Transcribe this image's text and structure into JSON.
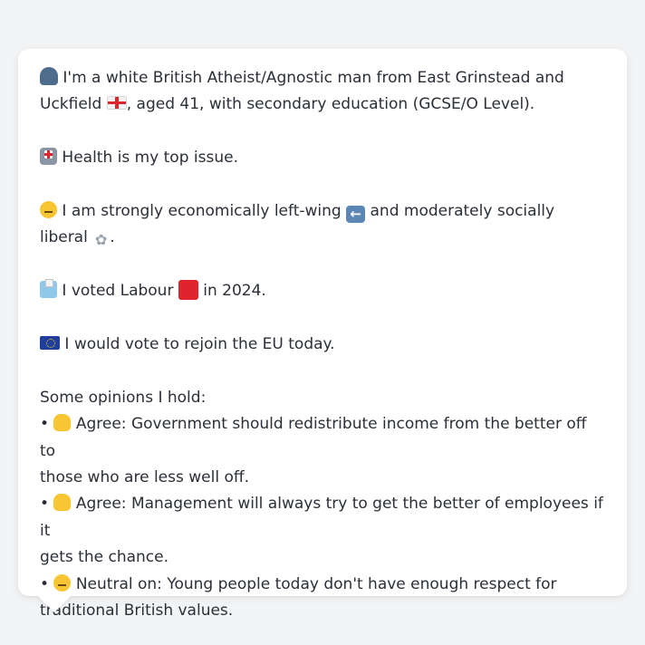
{
  "profile": {
    "intro_pre": "I'm a white British Atheist/Agnostic man from East Grinstead and Uckfield",
    "intro_post": ", aged 41, with secondary education (GCSE/O Level).",
    "top_issue": "Health is my top issue.",
    "ideology_pre": "I am strongly economically left-wing",
    "ideology_mid": "and moderately socially liberal",
    "ideology_post": ".",
    "vote_pre": "I voted Labour",
    "vote_post": "in 2024.",
    "eu": "I would vote to rejoin the EU today.",
    "opinions_heading": "Some opinions I hold:",
    "bullet_char": "•",
    "opinions": [
      {
        "stance": "Agree:",
        "line1": "Government should redistribute income from the better off to",
        "line2": "those who are less well off.",
        "icon": "thumbs-up-icon"
      },
      {
        "stance": "Agree:",
        "line1": "Management will always try to get the better of employees if it",
        "line2": "gets the chance.",
        "icon": "thumbs-up-icon"
      },
      {
        "stance": "Neutral on:",
        "line1": "Young people today don't have enough respect for",
        "line2": "traditional British values.",
        "icon": "neutral-face-icon"
      }
    ]
  },
  "icons": {
    "person": "person-silhouette-icon",
    "england_flag": "england-flag-icon",
    "hospital": "hospital-icon",
    "thinking": "thinking-face-icon",
    "left_arrow": "left-arrow-icon",
    "dove": "dove-icon",
    "ballot": "ballot-box-icon",
    "labour": "red-square-icon",
    "eu_flag": "eu-flag-icon"
  },
  "colors": {
    "background": "#f3f4f6",
    "bubble": "#ffffff",
    "text": "#2b2f38",
    "labour_red": "#e0242e",
    "eu_blue": "#1f3e9e"
  }
}
